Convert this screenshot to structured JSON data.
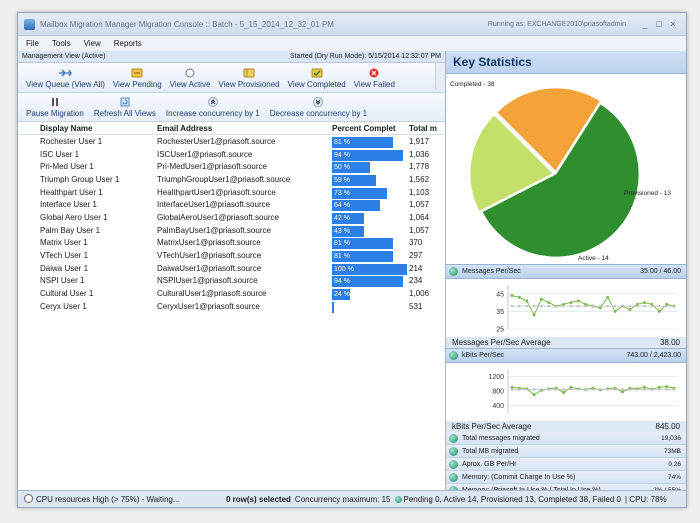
{
  "window": {
    "title": "Mailbox Migration Manager Migration Console :: Batch - 5_15_2014_12_32_01 PM",
    "running_as": "Running as: EXCHANGE2010\\priasoftadmin",
    "controls": [
      "_",
      "□",
      "×"
    ]
  },
  "menu": [
    "File",
    "Tools",
    "View",
    "Reports"
  ],
  "management_view": {
    "label": "Management View (Active)",
    "started": "Started (Dry Run Mode): 5/15/2014 12:32:07 PM"
  },
  "toolbar": [
    {
      "label": "View Queue (View All)",
      "icon": "list-arrows-icon"
    },
    {
      "label": "View Pending",
      "icon": "pending-icon"
    },
    {
      "label": "View Active",
      "icon": "active-circle-icon"
    },
    {
      "label": "View Provisioned",
      "icon": "provisioned-icon"
    },
    {
      "label": "View Completed",
      "icon": "completed-icon"
    },
    {
      "label": "View Failed",
      "icon": "failed-icon"
    }
  ],
  "toolbar2": [
    {
      "label": "Pause Migration",
      "icon": "pause-icon"
    },
    {
      "label": "Refresh All Views",
      "icon": "refresh-icon"
    },
    {
      "label": "Increase concurrency by 1",
      "icon": "chevron-up-icon"
    },
    {
      "label": "Decrease concurrency by 1",
      "icon": "chevron-down-icon"
    }
  ],
  "grid": {
    "columns": [
      "Display Name",
      "Email Address",
      "Percent Complet",
      "Total m"
    ],
    "rows": [
      {
        "name": "Rochester User 1",
        "email": "RochesterUser1@priasoft.source",
        "pct": 81,
        "pct_label": "81 %",
        "total": "1,917"
      },
      {
        "name": "ISC User 1",
        "email": "ISCUser1@priasoft.source",
        "pct": 94,
        "pct_label": "94 %",
        "total": "1,036"
      },
      {
        "name": "Pri-Med User 1",
        "email": "Pri-MedUser1@priasoft.source",
        "pct": 50,
        "pct_label": "50 %",
        "total": "1,778"
      },
      {
        "name": "Triumph Group User 1",
        "email": "TriumphGroupUser1@priasoft.source",
        "pct": 59,
        "pct_label": "59 %",
        "total": "1,562"
      },
      {
        "name": "Healthpart User 1",
        "email": "HealthpartUser1@priasoft.source",
        "pct": 73,
        "pct_label": "73 %",
        "total": "1,103"
      },
      {
        "name": "Interface User 1",
        "email": "InterfaceUser1@priasoft.source",
        "pct": 64,
        "pct_label": "64 %",
        "total": "1,057"
      },
      {
        "name": "Global Aero User 1",
        "email": "GlobalAeroUser1@priasoft.source",
        "pct": 42,
        "pct_label": "42 %",
        "total": "1,064"
      },
      {
        "name": "Palm Bay User 1",
        "email": "PalmBayUser1@priasoft.source",
        "pct": 43,
        "pct_label": "43 %",
        "total": "1,057"
      },
      {
        "name": "Matrix User 1",
        "email": "MatrixUser1@priasoft.source",
        "pct": 81,
        "pct_label": "81 %",
        "total": "370"
      },
      {
        "name": "VTech User 1",
        "email": "VTechUser1@priasoft.source",
        "pct": 81,
        "pct_label": "81 %",
        "total": "297"
      },
      {
        "name": "Daiwa User 1",
        "email": "DaiwaUser1@priasoft.source",
        "pct": 100,
        "pct_label": "100 %",
        "total": "214"
      },
      {
        "name": "NSPI User 1",
        "email": "NSPIUser1@priasoft.source",
        "pct": 94,
        "pct_label": "94 %",
        "total": "234"
      },
      {
        "name": "Cultural User 1",
        "email": "CulturalUser1@priasoft.source",
        "pct": 24,
        "pct_label": "24 %",
        "total": "1,006"
      },
      {
        "name": "Ceryx User 1",
        "email": "CeryxUser1@priasoft.source",
        "pct": 3,
        "pct_label": "3 %",
        "total": "531"
      }
    ]
  },
  "status": {
    "cpu_resources": "CPU resources High (> 75%) - Waiting...",
    "rows_selected": "0 row(s) selected",
    "concurrency": "Concurrency maximum: 15",
    "counts": "Pending 0, Active 14, Provisioned 13, Completed 38, Failed 0",
    "cpu": "| CPU: 78%"
  },
  "key_statistics": {
    "title": "Key Statistics",
    "pie": {
      "slices": [
        {
          "label": "Completed - 38",
          "value": 38,
          "color": "#2f8f2f"
        },
        {
          "label": "Provisioned - 13",
          "value": 13,
          "color": "#c3e06a"
        },
        {
          "label": "Active - 14",
          "value": 14,
          "color": "#f4a23a"
        }
      ]
    },
    "messages": {
      "label": "Messages Per/Sec",
      "value": "35.00 / 46.00",
      "avg_label": "Messages Per/Sec Average",
      "avg_value": "38.00",
      "y_ticks": [
        "45",
        "35",
        "25"
      ]
    },
    "kbits": {
      "label": "kBits Per/Sec",
      "value": "743.00 / 2,423.00",
      "avg_label": "kBits Per/Sec Average",
      "avg_value": "845.00",
      "y_ticks": [
        "1200",
        "800",
        "400"
      ]
    },
    "stats": [
      {
        "label": "Total messages migrated",
        "value": "19,036"
      },
      {
        "label": "Total MB migrated",
        "value": "73MB"
      },
      {
        "label": "Aprox. GB Per/Hr",
        "value": "0.26"
      },
      {
        "label": "Memory: (Commit Charge In Use %)",
        "value": "74%"
      },
      {
        "label": "Memory: (Priasoft In Use % / Total In Use %)",
        "value": "2% / 55%"
      }
    ]
  },
  "chart_data": [
    {
      "type": "pie",
      "categories": [
        "Completed",
        "Provisioned",
        "Active"
      ],
      "values": [
        38,
        13,
        14
      ],
      "labels": [
        "Completed - 38",
        "Provisioned - 13",
        "Active - 14"
      ]
    },
    {
      "type": "line",
      "ylabel": "Messages Per/Sec",
      "ylim": [
        25,
        50
      ],
      "series": [
        {
          "values": [
            44,
            43,
            41,
            33,
            42,
            40,
            38,
            39,
            40,
            41,
            39,
            38,
            37,
            43,
            35,
            38,
            36,
            39,
            40,
            39,
            35,
            39,
            38
          ]
        },
        {
          "values": [
            38,
            38,
            38,
            38,
            38,
            38,
            38,
            38,
            38,
            38,
            38,
            38,
            38,
            38,
            38,
            38,
            38,
            38,
            38,
            38,
            38,
            38,
            38
          ]
        }
      ]
    },
    {
      "type": "line",
      "ylabel": "kBits Per/Sec",
      "ylim": [
        200,
        1400
      ],
      "series": [
        {
          "values": [
            900,
            880,
            860,
            700,
            820,
            860,
            880,
            760,
            900,
            860,
            840,
            880,
            830,
            860,
            880,
            780,
            870,
            860,
            900,
            850,
            900,
            920,
            880
          ]
        },
        {
          "values": [
            845,
            845,
            845,
            845,
            845,
            845,
            845,
            845,
            845,
            845,
            845,
            845,
            845,
            845,
            845,
            845,
            845,
            845,
            845,
            845,
            845,
            845,
            845
          ]
        }
      ]
    }
  ]
}
